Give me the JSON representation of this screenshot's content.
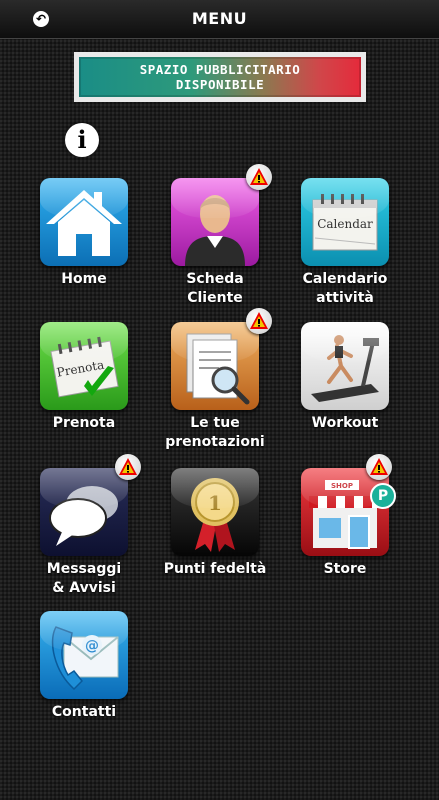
{
  "header": {
    "title": "MENU",
    "back_icon": "back-arrow-icon"
  },
  "ad_banner": {
    "line1": "SPAZIO PUBBLICITARIO",
    "line2": "DISPONIBILE"
  },
  "info_button": {
    "glyph": "i"
  },
  "tiles": [
    {
      "id": "home",
      "label": "Home",
      "icon": "home-icon",
      "warning": false
    },
    {
      "id": "scheda-cliente",
      "label_line1": "Scheda",
      "label_line2": "Cliente",
      "icon": "user-profile-icon",
      "warning": true
    },
    {
      "id": "calendario",
      "label_line1": "Calendario",
      "label_line2": "attività",
      "icon_text": "Calendar",
      "icon": "calendar-icon",
      "warning": false
    },
    {
      "id": "prenota",
      "label": "Prenota",
      "icon_text": "Prenota",
      "icon": "booking-calendar-icon",
      "warning": false
    },
    {
      "id": "le-tue-prenotazioni",
      "label_line1": "Le tue",
      "label_line2": "prenotazioni",
      "icon": "document-search-icon",
      "warning": true
    },
    {
      "id": "workout",
      "label": "Workout",
      "icon": "treadmill-icon",
      "warning": false
    },
    {
      "id": "messaggi",
      "label_line1": "Messaggi",
      "label_line2": "& Avvisi",
      "icon": "chat-bubbles-icon",
      "warning": true
    },
    {
      "id": "punti-fedelta",
      "label": "Punti fedeltà",
      "icon": "award-ribbon-icon",
      "warning": false
    },
    {
      "id": "store",
      "label": "Store",
      "icon_text": "SHOP",
      "icon": "shop-icon",
      "warning": true,
      "badge": "P"
    },
    {
      "id": "contatti",
      "label": "Contatti",
      "icon_text": "@",
      "icon": "contact-mail-icon",
      "warning": false
    }
  ],
  "colors": {
    "background": "#1b1b1b",
    "warning": "#f2c500",
    "badge": "#1bb19a"
  }
}
